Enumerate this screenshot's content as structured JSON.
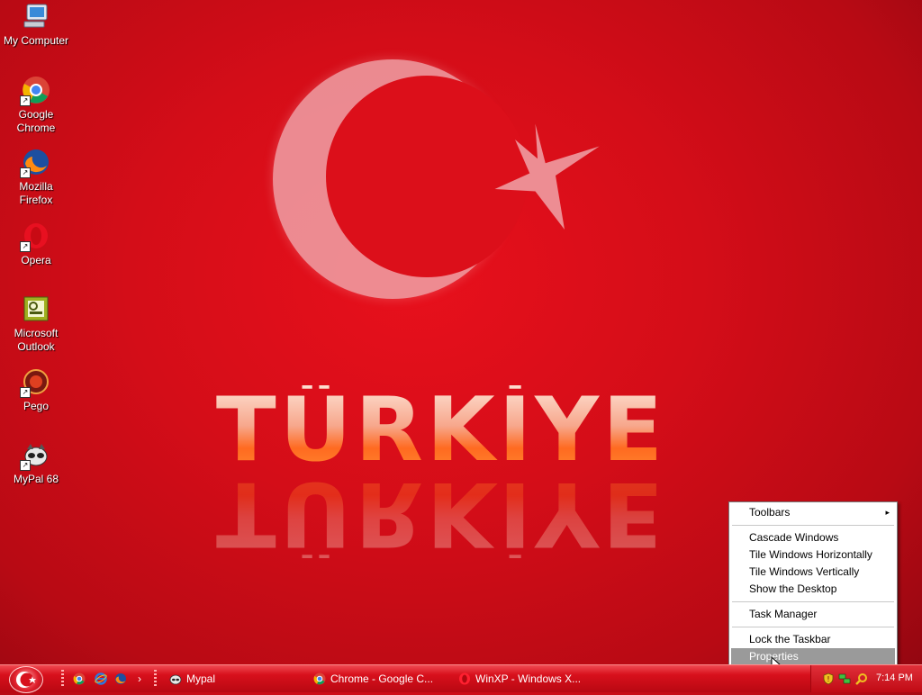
{
  "desktop": {
    "icons": [
      {
        "label": "My Computer",
        "icon": "my-computer-icon"
      },
      {
        "label": "Google Chrome",
        "icon": "chrome-icon"
      },
      {
        "label": "Mozilla Firefox",
        "icon": "firefox-icon"
      },
      {
        "label": "Opera",
        "icon": "opera-icon"
      },
      {
        "label": "Microsoft Outlook",
        "icon": "outlook-icon"
      },
      {
        "label": "Pego",
        "icon": "pego-icon"
      },
      {
        "label": "MyPal 68",
        "icon": "mypal-icon"
      }
    ],
    "wallpaper_text": "TÜRKİYE"
  },
  "context_menu": {
    "items": [
      {
        "label": "Toolbars",
        "has_submenu": true
      },
      {
        "label": "Cascade Windows"
      },
      {
        "label": "Tile Windows Horizontally"
      },
      {
        "label": "Tile Windows Vertically"
      },
      {
        "label": "Show the Desktop"
      },
      {
        "label": "Task Manager"
      },
      {
        "label": "Lock the Taskbar"
      },
      {
        "label": "Properties",
        "selected": true
      }
    ],
    "submenu_arrow": "▸"
  },
  "taskbar": {
    "quick_launch": [
      "chrome-icon",
      "internet-explorer-icon",
      "firefox-icon"
    ],
    "chevron": "›",
    "tasks": [
      {
        "label": "Mypal",
        "icon": "mypal-icon"
      },
      {
        "label": "Chrome - Google C...",
        "icon": "chrome-icon"
      },
      {
        "label": "WinXP - Windows X...",
        "icon": "opera-icon"
      }
    ],
    "tray_icons": [
      "shield-icon",
      "network-icon",
      "search-icon"
    ],
    "clock": "7:14 PM"
  },
  "colors": {
    "accent": "#d40d18",
    "taskbar": "#c80a14",
    "menu_highlight": "#9a9a9a"
  }
}
